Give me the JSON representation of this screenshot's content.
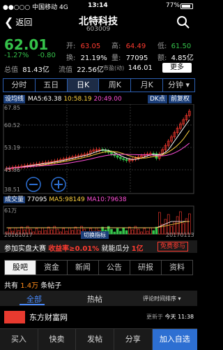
{
  "status": {
    "carrier": "●●○○○ 中国移动 4G",
    "time": "13:14",
    "battery": "77%"
  },
  "nav": {
    "back": "返回",
    "title": "北特科技",
    "code": "603009"
  },
  "quote": {
    "price": "62.01",
    "change_pct": "-1.27%",
    "change": "-0.80",
    "open_label": "开:",
    "open": "63.05",
    "high_label": "高:",
    "high": "64.49",
    "low_label": "低:",
    "low": "61.50",
    "turnover_label": "换:",
    "turnover": "21.19%",
    "volume_label": "量:",
    "volume": "77095",
    "amount_label": "额:",
    "amount": "4.85亿",
    "totalcap_label": "总值",
    "totalcap": "81.43亿",
    "floatcap_label": "流值",
    "floatcap": "22.56亿",
    "pb_label": "市盈(动)",
    "pb": "146.01",
    "more": "更多"
  },
  "period_tabs": [
    "分时",
    "五日",
    "日K",
    "周K",
    "月K",
    "分钟 ▾"
  ],
  "chart": {
    "ma_setting": "设均线",
    "ma5": "MA5:63.38",
    "ma10": "10:58.19",
    "ma20": "20:49.00",
    "dk_label": "DK点",
    "fq_label": "前复权",
    "y_top": "67.85",
    "y_1": "60.52",
    "y_2": "53.19",
    "y_3": "45.86",
    "y_4": "38.51",
    "vol_label": "成交量",
    "vol": "77095",
    "vol_ma5": "MA5:98149",
    "vol_ma10": "MA10:79638",
    "vol_top": "61万",
    "x_start": "20161017",
    "x_end": "20170113",
    "switch_label": "切换指标"
  },
  "chart_data": {
    "type": "candlestick",
    "x": [
      "20161017",
      "20170113"
    ],
    "ylim": [
      38.51,
      67.85
    ],
    "yticks": [
      38.51,
      45.86,
      53.19,
      60.52,
      67.85
    ],
    "series": [
      {
        "name": "MA5",
        "value": 63.38
      },
      {
        "name": "MA10",
        "value": 58.19
      },
      {
        "name": "MA20",
        "value": 49.0
      }
    ],
    "volume": {
      "latest": 77095,
      "MA5": 98149,
      "MA10": 79638,
      "max": "61万"
    }
  },
  "promo": {
    "text1": "参加实盘大赛",
    "text2": "收益率≥0.01%",
    "text3": "就能瓜分",
    "text4": "1亿",
    "button": "免费参与"
  },
  "info_tabs": [
    "股吧",
    "资金",
    "新闻",
    "公告",
    "研报",
    "资料"
  ],
  "posts": {
    "prefix": "共有",
    "count": "1.4万",
    "suffix": "条帖子"
  },
  "sub_tabs": {
    "all": "全部",
    "hot": "热帖",
    "sort": "评论时间排序 ▾"
  },
  "news": {
    "source": "东方财富网",
    "update_label": "更新于",
    "update_time": "今天 11:38"
  },
  "bottom_bar": [
    "买入",
    "快卖",
    "发帖",
    "分享",
    "加入自选"
  ]
}
